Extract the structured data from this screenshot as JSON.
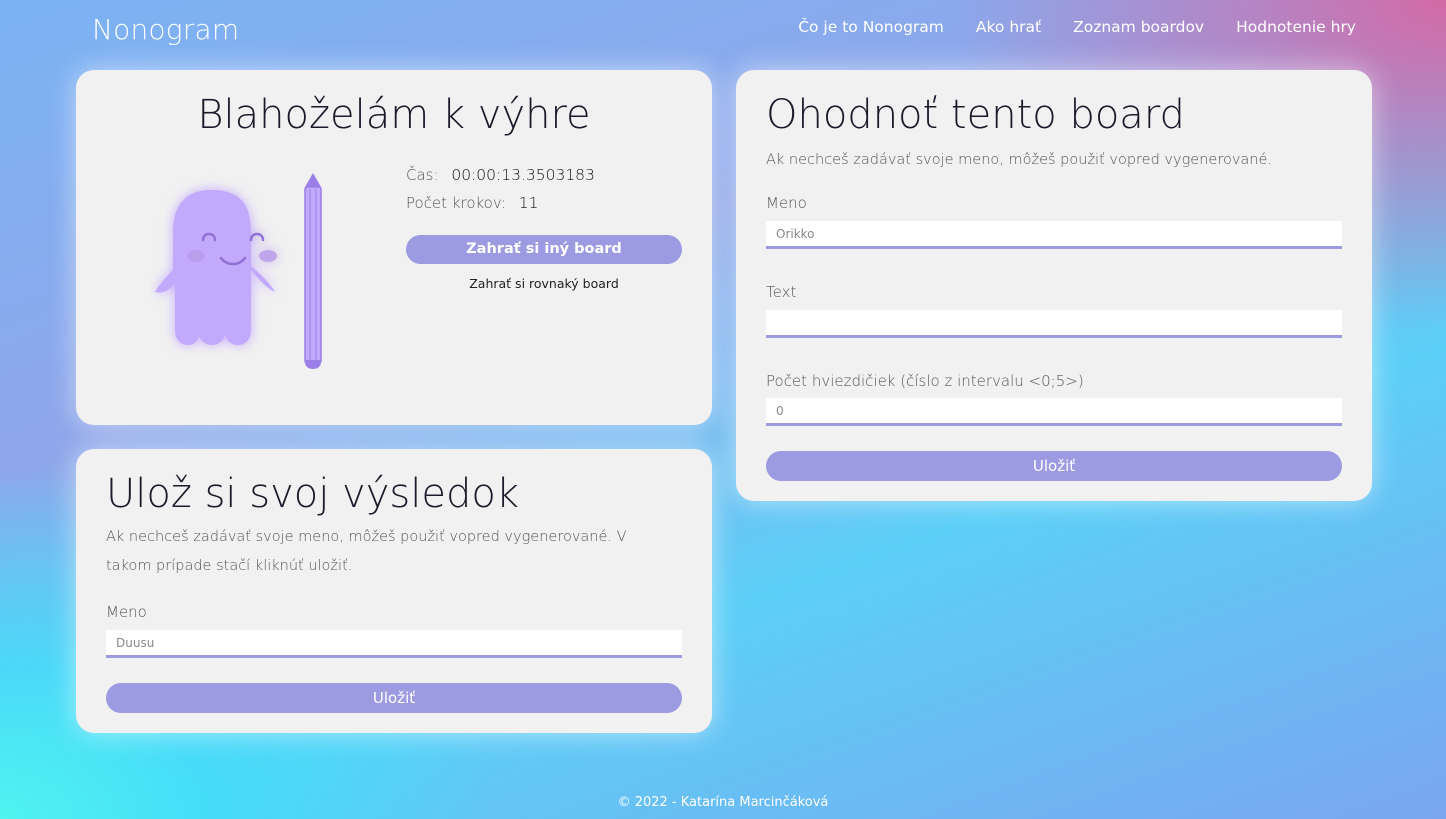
{
  "nav": {
    "brand": "Nonogram",
    "items": [
      {
        "label": "Čo je to Nonogram"
      },
      {
        "label": "Ako hrať"
      },
      {
        "label": "Zoznam boardov"
      },
      {
        "label": "Hodnotenie hry"
      }
    ]
  },
  "win": {
    "title": "Blahoželám k výhre",
    "time_label": "Čas:",
    "time_value": "00:00:13.3503183",
    "steps_label": "Počet krokov:",
    "steps_value": "11",
    "play_other": "Zahrať si iný board",
    "play_same": "Zahrať si rovnaký board"
  },
  "save": {
    "title": "Ulož si svoj výsledok",
    "description": "Ak nechceš zadávať svoje meno, môžeš použiť vopred vygenerované. V takom prípade stačí kliknúť uložiť.",
    "name_label": "Meno",
    "name_placeholder": "Duusu",
    "button": "Uložiť"
  },
  "rate": {
    "title": "Ohodnoť tento board",
    "description": "Ak nechceš zadávať svoje meno, môžeš použiť vopred vygenerované.",
    "name_label": "Meno",
    "name_placeholder": "Orikko",
    "text_label": "Text",
    "text_placeholder": "",
    "stars_label": "Počet hviezdičiek (číslo z intervalu <0;5>)",
    "stars_placeholder": "0",
    "button": "Uložiť"
  },
  "footer": "© 2022 - Katarína Marcinčáková",
  "colors": {
    "accent": "#9c9ae0",
    "ghost": "#c3a9fb",
    "pencil": "#9b7ee6",
    "card": "#f1f1f1"
  }
}
